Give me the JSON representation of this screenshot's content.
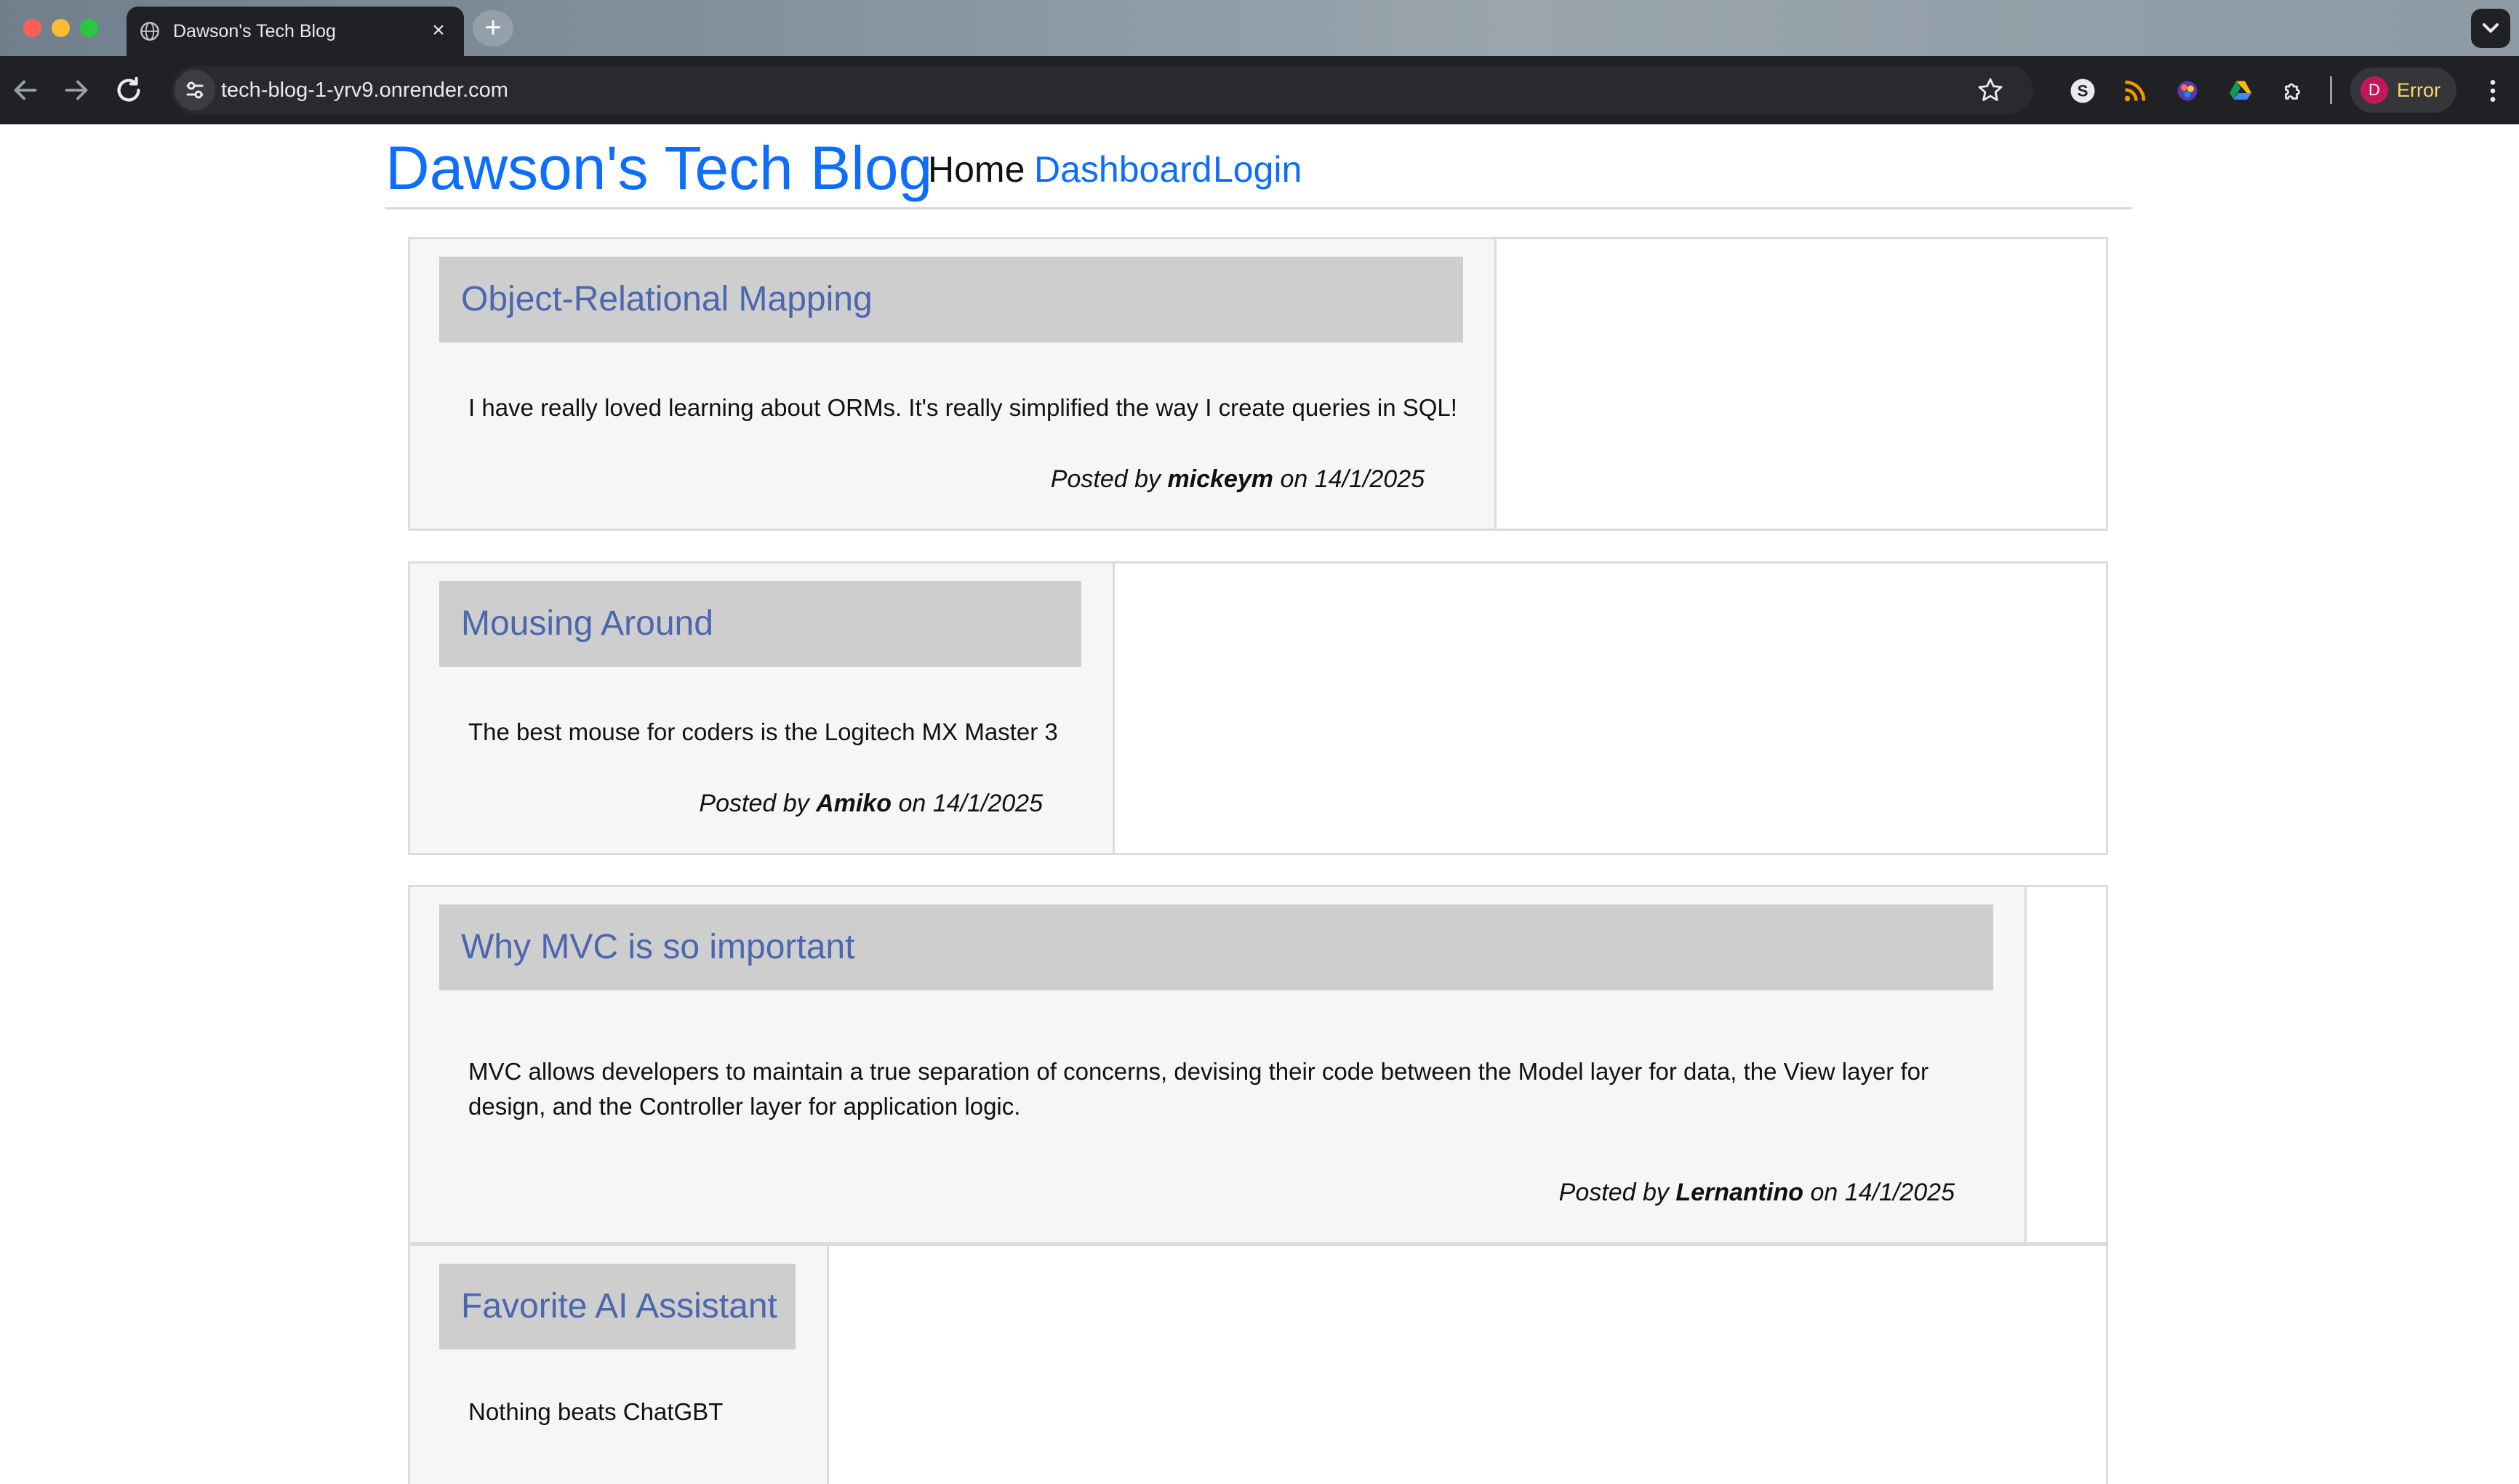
{
  "browser": {
    "tab_title": "Dawson's Tech Blog",
    "tab_close": "×",
    "new_tab": "+",
    "url": "tech-blog-1-yrv9.onrender.com",
    "profile_initial": "D",
    "profile_status": "Error"
  },
  "site": {
    "title": "Dawson's Tech Blog",
    "nav": {
      "home": "Home",
      "dashboard": "Dashboard",
      "login": "Login"
    }
  },
  "posts": [
    {
      "title": "Object-Relational Mapping",
      "content": "I have really loved learning about ORMs. It's really simplified the way I create queries in SQL!",
      "posted_by_prefix": "Posted by",
      "author": "mickeym",
      "on_word": "on",
      "date": "14/1/2025"
    },
    {
      "title": "Mousing Around",
      "content": "The best mouse for coders is the Logitech MX Master 3",
      "posted_by_prefix": "Posted by",
      "author": "Amiko",
      "on_word": "on",
      "date": "14/1/2025"
    },
    {
      "title": "Why MVC is so important",
      "content": "MVC allows developers to maintain a true separation of concerns, devising their code between the Model layer for data, the View layer for design, and the Controller layer for application logic.",
      "posted_by_prefix": "Posted by",
      "author": "Lernantino",
      "on_word": "on",
      "date": "14/1/2025"
    },
    {
      "title": "Favorite AI Assistant",
      "content": "Nothing beats ChatGBT"
    }
  ],
  "colors": {
    "link": "#0d6efd",
    "post_title": "#4b67ae",
    "title_box": "#cecece",
    "card_bg": "#f6f6f6"
  }
}
